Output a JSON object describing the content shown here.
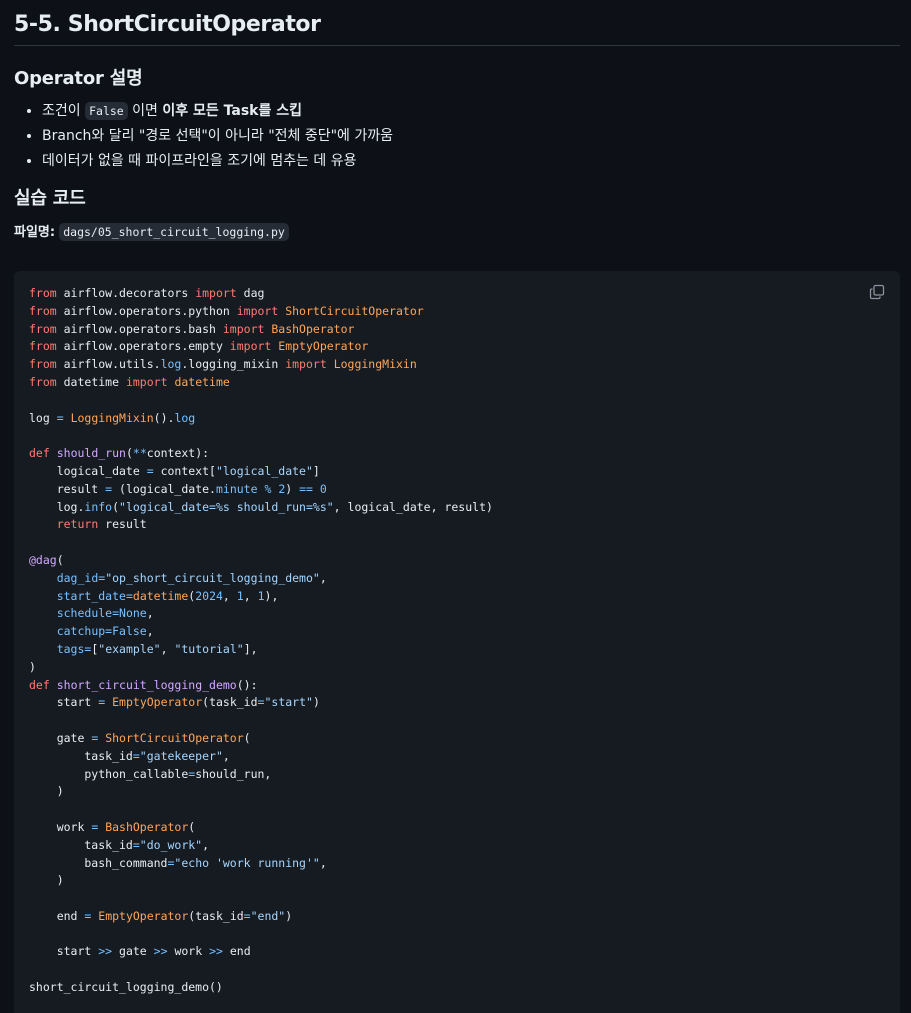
{
  "page_title": "5-5. ShortCircuitOperator",
  "section_operator": {
    "heading": "Operator 설명",
    "bullets": [
      {
        "pre": "조건이 ",
        "code": "False",
        "mid": " 이면 ",
        "bold": "이후 모든 Task를 스킵"
      },
      {
        "text": "Branch와 달리 \"경로 선택\"이 아니라 \"전체 중단\"에 가까움"
      },
      {
        "text": "데이터가 없을 때 파이프라인을 조기에 멈추는 데 유용"
      }
    ]
  },
  "section_practice": {
    "heading": "실습 코드",
    "filename_label": "파일명:",
    "filename": "dags/05_short_circuit_logging.py"
  },
  "code_block": {
    "language": "python",
    "copy_icon": "copy-icon",
    "lines": [
      "from airflow.decorators import dag",
      "from airflow.operators.python import ShortCircuitOperator",
      "from airflow.operators.bash import BashOperator",
      "from airflow.operators.empty import EmptyOperator",
      "from airflow.utils.log.logging_mixin import LoggingMixin",
      "from datetime import datetime",
      "",
      "log = LoggingMixin().log",
      "",
      "def should_run(**context):",
      "    logical_date = context[\"logical_date\"]",
      "    result = (logical_date.minute % 2) == 0",
      "    log.info(\"logical_date=%s should_run=%s\", logical_date, result)",
      "    return result",
      "",
      "@dag(",
      "    dag_id=\"op_short_circuit_logging_demo\",",
      "    start_date=datetime(2024, 1, 1),",
      "    schedule=None,",
      "    catchup=False,",
      "    tags=[\"example\", \"tutorial\"],",
      ")",
      "def short_circuit_logging_demo():",
      "    start = EmptyOperator(task_id=\"start\")",
      "",
      "    gate = ShortCircuitOperator(",
      "        task_id=\"gatekeeper\",",
      "        python_callable=should_run,",
      "    )",
      "",
      "    work = BashOperator(",
      "        task_id=\"do_work\",",
      "        bash_command=\"echo 'work running'\",",
      "    )",
      "",
      "    end = EmptyOperator(task_id=\"end\")",
      "",
      "    start >> gate >> work >> end",
      "",
      "short_circuit_logging_demo()"
    ]
  },
  "colors": {
    "background": "#0d1117",
    "code_background": "#161b22",
    "keyword": "#ff7b72",
    "string": "#a5d6ff",
    "class_name": "#ffa657",
    "function_name": "#d2a8ff",
    "number": "#79c0ff"
  }
}
